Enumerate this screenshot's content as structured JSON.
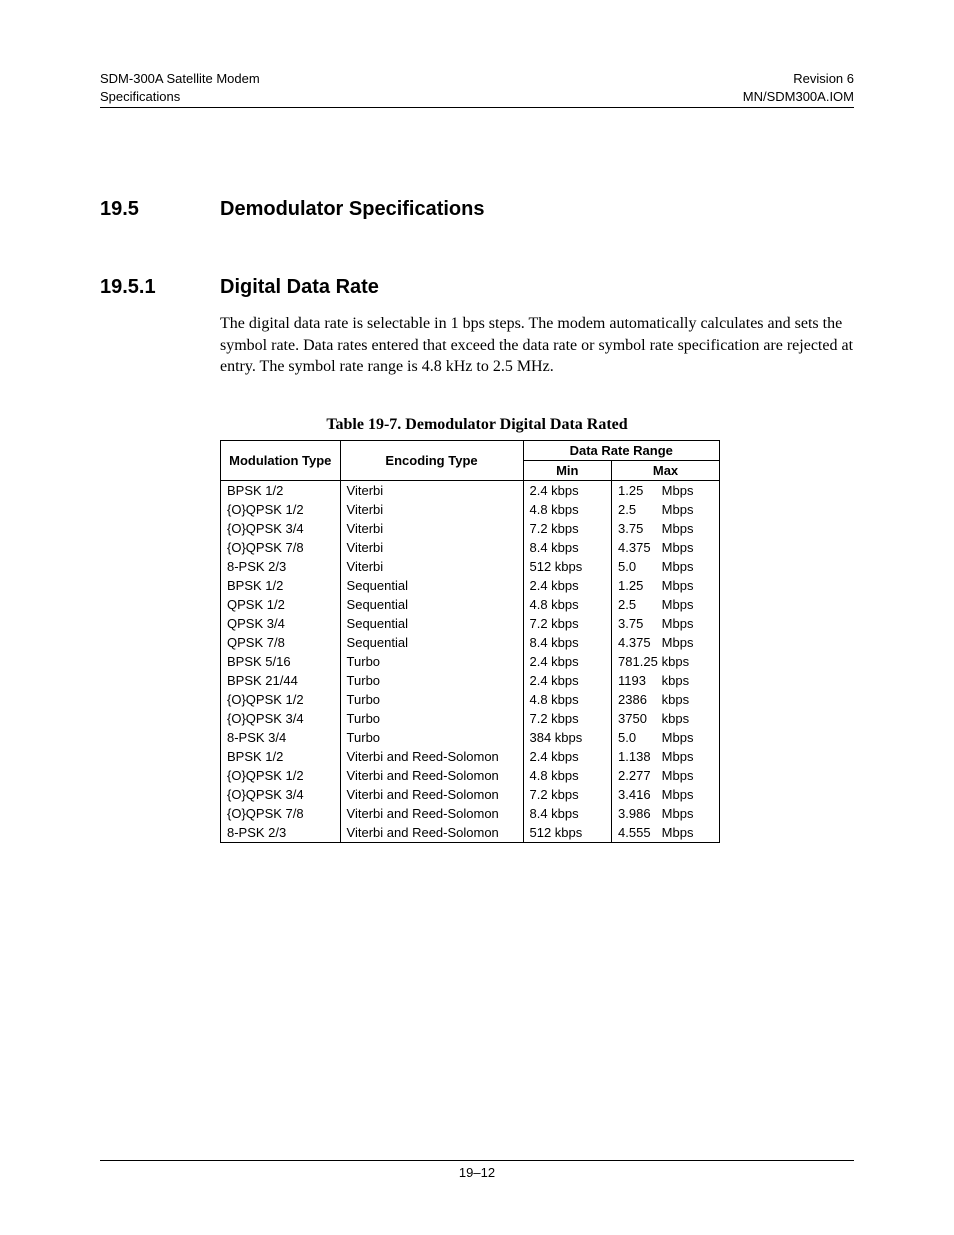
{
  "header": {
    "left_line1": "SDM-300A Satellite Modem",
    "left_line2": "Specifications",
    "right_line1": "Revision 6",
    "right_line2": "MN/SDM300A.IOM"
  },
  "section": {
    "number": "19.5",
    "title": "Demodulator Specifications"
  },
  "subsection": {
    "number": "19.5.1",
    "title": "Digital Data Rate",
    "paragraph": "The digital data rate is selectable in 1 bps steps. The modem automatically calculates and sets the symbol rate. Data rates entered that exceed the data rate or symbol rate specification are rejected at entry. The symbol rate range is 4.8 kHz to 2.5 MHz."
  },
  "table": {
    "caption": "Table 19-7.  Demodulator Digital Data Rated",
    "headers": {
      "modulation": "Modulation Type",
      "encoding": "Encoding Type",
      "range": "Data Rate Range",
      "min": "Min",
      "max": "Max"
    },
    "rows": [
      {
        "mod": "BPSK 1/2",
        "enc": "Viterbi",
        "min": "2.4 kbps",
        "max_val": "1.25",
        "max_unit": "Mbps"
      },
      {
        "mod": "{O}QPSK 1/2",
        "enc": "Viterbi",
        "min": "4.8 kbps",
        "max_val": "2.5",
        "max_unit": "Mbps"
      },
      {
        "mod": "{O}QPSK 3/4",
        "enc": "Viterbi",
        "min": "7.2 kbps",
        "max_val": "3.75",
        "max_unit": "Mbps"
      },
      {
        "mod": "{O}QPSK 7/8",
        "enc": "Viterbi",
        "min": "8.4 kbps",
        "max_val": "4.375",
        "max_unit": "Mbps"
      },
      {
        "mod": "8-PSK 2/3",
        "enc": "Viterbi",
        "min": "512 kbps",
        "max_val": "5.0",
        "max_unit": "Mbps"
      },
      {
        "mod": "BPSK 1/2",
        "enc": "Sequential",
        "min": "2.4 kbps",
        "max_val": "1.25",
        "max_unit": "Mbps"
      },
      {
        "mod": "QPSK 1/2",
        "enc": "Sequential",
        "min": "4.8 kbps",
        "max_val": "2.5",
        "max_unit": "Mbps"
      },
      {
        "mod": "QPSK 3/4",
        "enc": "Sequential",
        "min": "7.2 kbps",
        "max_val": "3.75",
        "max_unit": "Mbps"
      },
      {
        "mod": "QPSK 7/8",
        "enc": "Sequential",
        "min": "8.4 kbps",
        "max_val": "4.375",
        "max_unit": "Mbps"
      },
      {
        "mod": "BPSK 5/16",
        "enc": "Turbo",
        "min": "2.4 kbps",
        "max_val": "781.25",
        "max_unit": "kbps"
      },
      {
        "mod": "BPSK 21/44",
        "enc": "Turbo",
        "min": "2.4 kbps",
        "max_val": "1193",
        "max_unit": "kbps"
      },
      {
        "mod": "{O}QPSK 1/2",
        "enc": "Turbo",
        "min": "4.8 kbps",
        "max_val": "2386",
        "max_unit": "kbps"
      },
      {
        "mod": "{O}QPSK 3/4",
        "enc": "Turbo",
        "min": "7.2 kbps",
        "max_val": "3750",
        "max_unit": "kbps"
      },
      {
        "mod": "8-PSK 3/4",
        "enc": "Turbo",
        "min": "384 kbps",
        "max_val": "5.0",
        "max_unit": "Mbps"
      },
      {
        "mod": "BPSK 1/2",
        "enc": "Viterbi and Reed-Solomon",
        "min": "2.4 kbps",
        "max_val": "1.138",
        "max_unit": "Mbps"
      },
      {
        "mod": "{O}QPSK 1/2",
        "enc": "Viterbi and Reed-Solomon",
        "min": "4.8 kbps",
        "max_val": "2.277",
        "max_unit": "Mbps"
      },
      {
        "mod": "{O}QPSK 3/4",
        "enc": "Viterbi and Reed-Solomon",
        "min": "7.2 kbps",
        "max_val": "3.416",
        "max_unit": "Mbps"
      },
      {
        "mod": "{O}QPSK 7/8",
        "enc": "Viterbi and Reed-Solomon",
        "min": "8.4 kbps",
        "max_val": "3.986",
        "max_unit": "Mbps"
      },
      {
        "mod": "8-PSK 2/3",
        "enc": "Viterbi and Reed-Solomon",
        "min": "512 kbps",
        "max_val": "4.555",
        "max_unit": "Mbps"
      }
    ]
  },
  "footer": {
    "page_number": "19–12"
  }
}
